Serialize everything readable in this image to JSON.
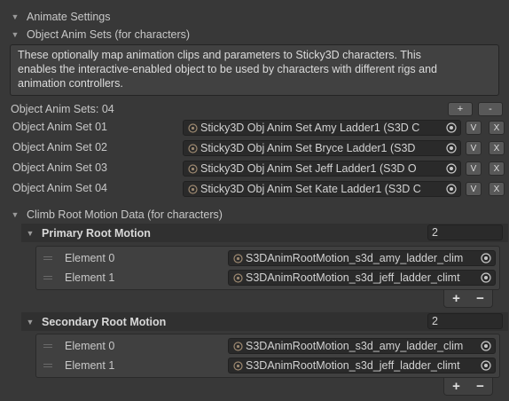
{
  "animate_settings": {
    "label": "Animate Settings"
  },
  "object_anim_sets": {
    "label": "Object Anim Sets (for characters)",
    "help_lines": [
      "These optionally map animation clips and parameters to Sticky3D characters. This",
      "enables the interactive-enabled object to be used by characters with different rigs and",
      "animation controllers."
    ],
    "count_label": "Object Anim Sets: 04",
    "add_button": "+",
    "remove_button": "-",
    "view_button": "V",
    "delete_button": "X",
    "sets": [
      {
        "label": "Object Anim Set 01",
        "value": "Sticky3D Obj Anim Set Amy Ladder1 (S3D C"
      },
      {
        "label": "Object Anim Set 02",
        "value": "Sticky3D Obj Anim Set Bryce Ladder1 (S3D"
      },
      {
        "label": "Object Anim Set 03",
        "value": "Sticky3D Obj Anim Set Jeff Ladder1 (S3D O"
      },
      {
        "label": "Object Anim Set 04",
        "value": "Sticky3D Obj Anim Set Kate Ladder1 (S3D C"
      }
    ]
  },
  "climb_root_motion": {
    "label": "Climb Root Motion Data (for characters)",
    "primary": {
      "label": "Primary Root Motion",
      "count": "2",
      "elements": [
        {
          "label": "Element 0",
          "value": "S3DAnimRootMotion_s3d_amy_ladder_clim"
        },
        {
          "label": "Element 1",
          "value": "S3DAnimRootMotion_s3d_jeff_ladder_climt"
        }
      ],
      "add": "+",
      "remove": "−"
    },
    "secondary": {
      "label": "Secondary Root Motion",
      "count": "2",
      "elements": [
        {
          "label": "Element 0",
          "value": "S3DAnimRootMotion_s3d_amy_ladder_clim"
        },
        {
          "label": "Element 1",
          "value": "S3DAnimRootMotion_s3d_jeff_ladder_climt"
        }
      ],
      "add": "+",
      "remove": "−"
    }
  }
}
